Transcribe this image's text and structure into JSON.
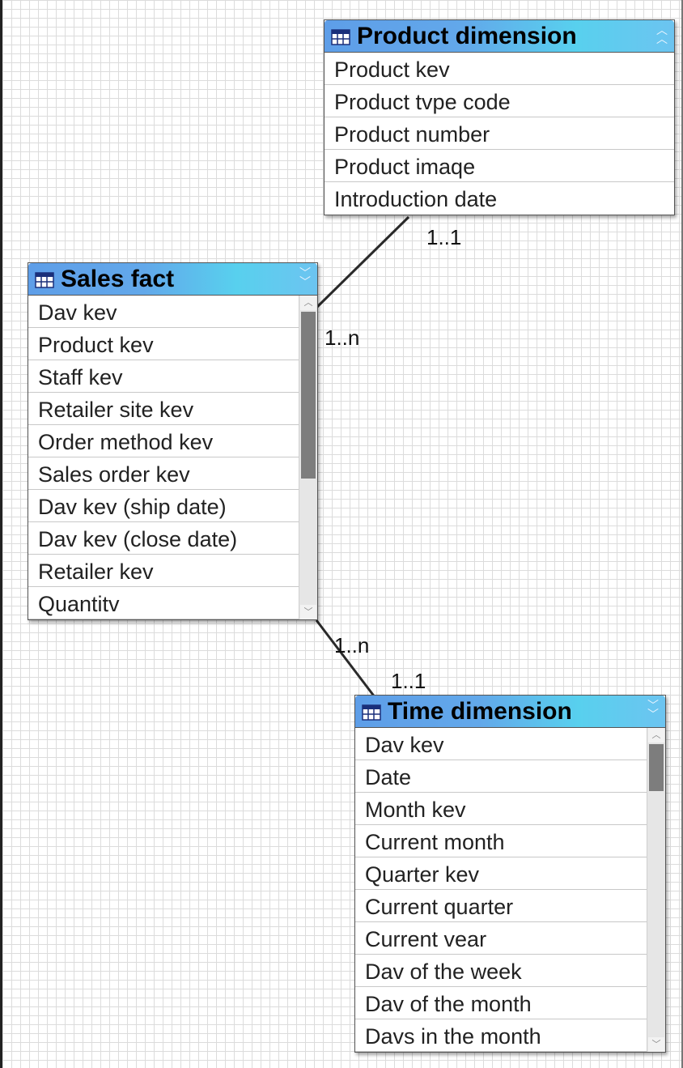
{
  "relationships": [
    {
      "from": "Sales fact",
      "to": "Product dimension",
      "from_cardinality": "1..n",
      "to_cardinality": "1..1"
    },
    {
      "from": "Sales fact",
      "to": "Time dimension",
      "from_cardinality": "1..n",
      "to_cardinality": "1..1"
    }
  ],
  "product_dimension": {
    "title": "Product dimension",
    "icon": "table-icon",
    "header_button": "collapse-up-icon",
    "rows": [
      "Product kev",
      "Product tvpe code",
      "Product number",
      "Product imaqe",
      "Introduction date"
    ]
  },
  "sales_fact": {
    "title": "Sales fact",
    "icon": "table-icon",
    "header_button": "expand-down-icon",
    "rows": [
      "Dav kev",
      "Product kev",
      "Staff kev",
      "Retailer site kev",
      "Order method kev",
      "Sales order kev",
      "Dav kev (ship date)",
      "Dav kev (close date)",
      "Retailer kev",
      "Quantitv"
    ]
  },
  "time_dimension": {
    "title": "Time dimension",
    "icon": "table-icon",
    "header_button": "expand-down-icon",
    "rows": [
      "Dav kev",
      "Date",
      "Month kev",
      "Current month",
      "Quarter kev",
      "Current quarter",
      "Current vear",
      "Dav of the week",
      "Dav of the month",
      "Davs in the month"
    ]
  },
  "colors": {
    "header_gradient_start": "#5e9ee8",
    "header_gradient_end": "#58d0ee",
    "connector": "#2a2a2a",
    "grid": "#dcdcdc"
  }
}
